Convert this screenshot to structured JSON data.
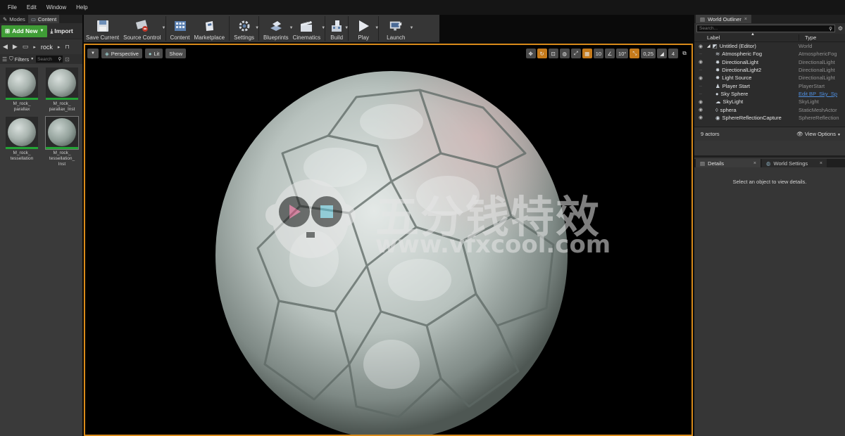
{
  "menu": [
    "File",
    "Edit",
    "Window",
    "Help"
  ],
  "left_tabs": [
    {
      "label": "Modes"
    },
    {
      "label": "Content"
    }
  ],
  "content_browser": {
    "add_new_label": "Add New",
    "import_label": "Import",
    "path_segment": "rock",
    "filters_label": "Filters",
    "search_placeholder": "Search",
    "assets": [
      {
        "line1": "M_rock_",
        "line2": "parallax",
        "line3": ""
      },
      {
        "line1": "M_rock_",
        "line2": "parallax_Inst",
        "line3": ""
      },
      {
        "line1": "M_rock_",
        "line2": "tessellation",
        "line3": ""
      },
      {
        "line1": "M_rock_",
        "line2": "tessellation_",
        "line3": "Inst"
      }
    ]
  },
  "toolbar": [
    {
      "label": "Save Current",
      "icon": "save-icon"
    },
    {
      "label": "Source Control",
      "icon": "source-control-icon"
    },
    {
      "label": "Content",
      "icon": "content-icon"
    },
    {
      "label": "Marketplace",
      "icon": "marketplace-icon"
    },
    {
      "label": "Settings",
      "icon": "settings-icon"
    },
    {
      "label": "Blueprints",
      "icon": "blueprints-icon"
    },
    {
      "label": "Cinematics",
      "icon": "cinematics-icon"
    },
    {
      "label": "Build",
      "icon": "build-icon"
    },
    {
      "label": "Play",
      "icon": "play-icon"
    },
    {
      "label": "Launch",
      "icon": "launch-icon"
    }
  ],
  "viewport": {
    "perspective_label": "Perspective",
    "lit_label": "Lit",
    "show_label": "Show",
    "grid_snap": "10",
    "rotation_snap": "10°",
    "scale_snap": "0,25",
    "camera_speed": "4"
  },
  "watermark": {
    "text_cn": "五分钱特效",
    "url": "www.vfxcool.com"
  },
  "outliner": {
    "tab_label": "World Outliner",
    "search_placeholder": "Search...",
    "col_label": "Label",
    "col_type": "Type",
    "rows": [
      {
        "label": "Untitled (Editor)",
        "type": "World",
        "visible": true,
        "link": false,
        "icon": "world-icon"
      },
      {
        "label": "Atmospheric Fog",
        "type": "AtmosphericFog",
        "visible": false,
        "link": false,
        "icon": "fog-icon"
      },
      {
        "label": "DirectionalLight",
        "type": "DirectionalLight",
        "visible": true,
        "link": false,
        "icon": "directional-light-icon"
      },
      {
        "label": "DirectionalLight2",
        "type": "DirectionalLight",
        "visible": false,
        "link": false,
        "icon": "directional-light-icon"
      },
      {
        "label": "Light Source",
        "type": "DirectionalLight",
        "visible": true,
        "link": false,
        "icon": "directional-light-icon"
      },
      {
        "label": "Player Start",
        "type": "PlayerStart",
        "visible": false,
        "link": false,
        "icon": "player-start-icon"
      },
      {
        "label": "Sky Sphere",
        "type": "Edit BP_Sky_Sp",
        "visible": false,
        "link": true,
        "icon": "sky-sphere-icon"
      },
      {
        "label": "SkyLight",
        "type": "SkyLight",
        "visible": true,
        "link": false,
        "icon": "skylight-icon"
      },
      {
        "label": "sphera",
        "type": "StaticMeshActor",
        "visible": true,
        "link": false,
        "icon": "static-mesh-icon"
      },
      {
        "label": "SphereReflectionCapture",
        "type": "SphereReflection",
        "visible": true,
        "link": false,
        "icon": "reflection-capture-icon"
      }
    ],
    "actor_count": "9 actors",
    "view_options_label": "View Options"
  },
  "details": {
    "tab_label": "Details",
    "world_settings_label": "World Settings",
    "empty_message": "Select an object to view details."
  },
  "colors": {
    "accent_orange": "#d88a1a",
    "add_new_green": "#3f9c36",
    "link_blue": "#4f8fe0"
  }
}
